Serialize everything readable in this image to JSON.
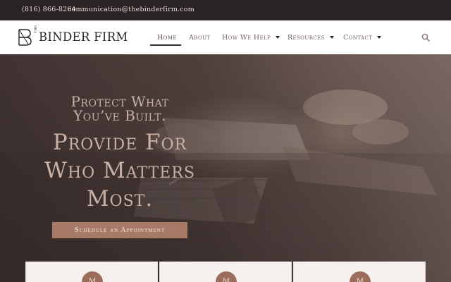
{
  "topbar": {
    "phone": "(816) 866-8264",
    "email": "communication@thebinderfirm.com"
  },
  "header": {
    "logo_small": "THE",
    "logo_text": "BINDER FIRM",
    "nav": [
      {
        "label": "Home",
        "active": true,
        "dropdown": false
      },
      {
        "label": "About",
        "active": false,
        "dropdown": false
      },
      {
        "label": "How We Help",
        "active": false,
        "dropdown": true
      },
      {
        "label": "Resources",
        "active": false,
        "dropdown": true
      },
      {
        "label": "Contact",
        "active": false,
        "dropdown": true
      }
    ],
    "search_icon": "search-icon"
  },
  "hero": {
    "kicker_line1": "Protect What",
    "kicker_line2": "You’ve Built.",
    "headline_line1": "Provide For",
    "headline_line2": "Who Matters",
    "headline_line3": "Most.",
    "cta_label": "Schedule an Appointment"
  },
  "cards": [
    {
      "icon_letter": "M"
    },
    {
      "icon_letter": "M"
    },
    {
      "icon_letter": "M"
    }
  ],
  "colors": {
    "topbar_bg": "#2a2326",
    "accent": "#a67a66",
    "hero_text": "#c9b0a4",
    "card_bg": "#f6f0ef"
  }
}
